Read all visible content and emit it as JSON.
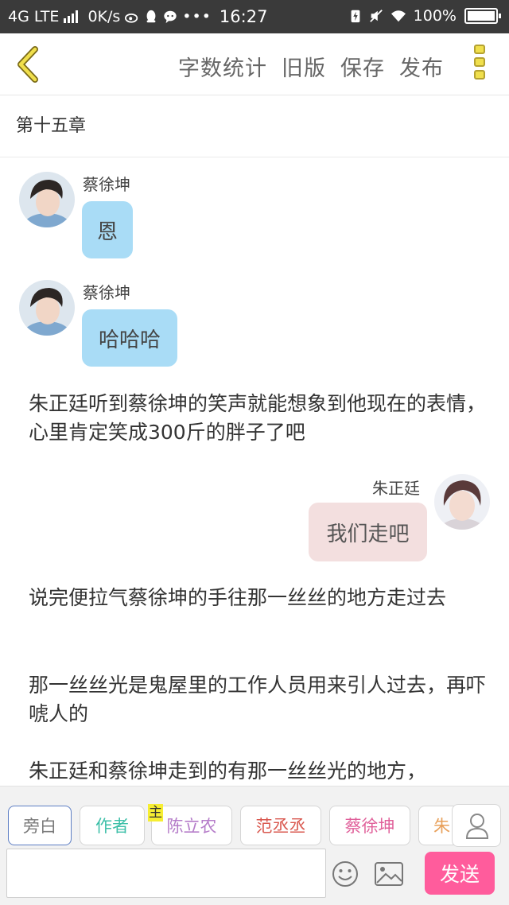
{
  "status_bar": {
    "network": "4G LTE",
    "speed": "0K/s",
    "time": "16:27",
    "battery": "100%",
    "icons": [
      "signal-icon",
      "weibo-icon",
      "qq-icon",
      "wechat-icon",
      "more-dots-icon",
      "battery-saver-icon",
      "mute-icon",
      "wifi-icon",
      "battery-icon"
    ]
  },
  "toolbar": {
    "back_icon": "chevron-left-icon",
    "actions": [
      "字数统计",
      "旧版",
      "保存",
      "发布"
    ],
    "more_icon": "menu-icon"
  },
  "chapter": {
    "title": "第十五章"
  },
  "messages": [
    {
      "type": "chat",
      "side": "left",
      "sender": "蔡徐坤",
      "text": "恩"
    },
    {
      "type": "chat",
      "side": "left",
      "sender": "蔡徐坤",
      "text": "哈哈哈"
    },
    {
      "type": "narration",
      "text": "朱正廷听到蔡徐坤的笑声就能想象到他现在的表情，心里肯定笑成300斤的胖子了吧"
    },
    {
      "type": "chat",
      "side": "right",
      "sender": "朱正廷",
      "text": "我们走吧"
    },
    {
      "type": "narration",
      "text": "说完便拉气蔡徐坤的手往那一丝丝的地方走过去"
    },
    {
      "type": "narration",
      "text": "那一丝丝光是鬼屋里的工作人员用来引人过去，再吓唬人的"
    },
    {
      "type": "narration",
      "text": "朱正廷和蔡徐坤走到的有那一丝丝光的地方，"
    }
  ],
  "roles": {
    "items": [
      {
        "label": "旁白",
        "color": "#7a7a7a",
        "selected": true
      },
      {
        "label": "作者",
        "color": "#3cbfa8",
        "selected": false
      },
      {
        "label": "陈立农",
        "color": "#b57cc9",
        "selected": false
      },
      {
        "label": "范丞丞",
        "color": "#d9584f",
        "selected": false
      },
      {
        "label": "蔡徐坤",
        "color": "#e0609a",
        "selected": false
      },
      {
        "label": "朱",
        "color": "#e8a05a",
        "selected": false
      }
    ],
    "main_tag": "主",
    "user_icon": "person-icon"
  },
  "composer": {
    "input_value": "",
    "emoji_icon": "smiley-icon",
    "image_icon": "image-icon",
    "send_label": "发送"
  },
  "colors": {
    "bubble_left": "#a9dcf6",
    "bubble_right": "#f3dfdf",
    "send_button": "#ff5c9c",
    "accent_yellow": "#f0df4c"
  }
}
